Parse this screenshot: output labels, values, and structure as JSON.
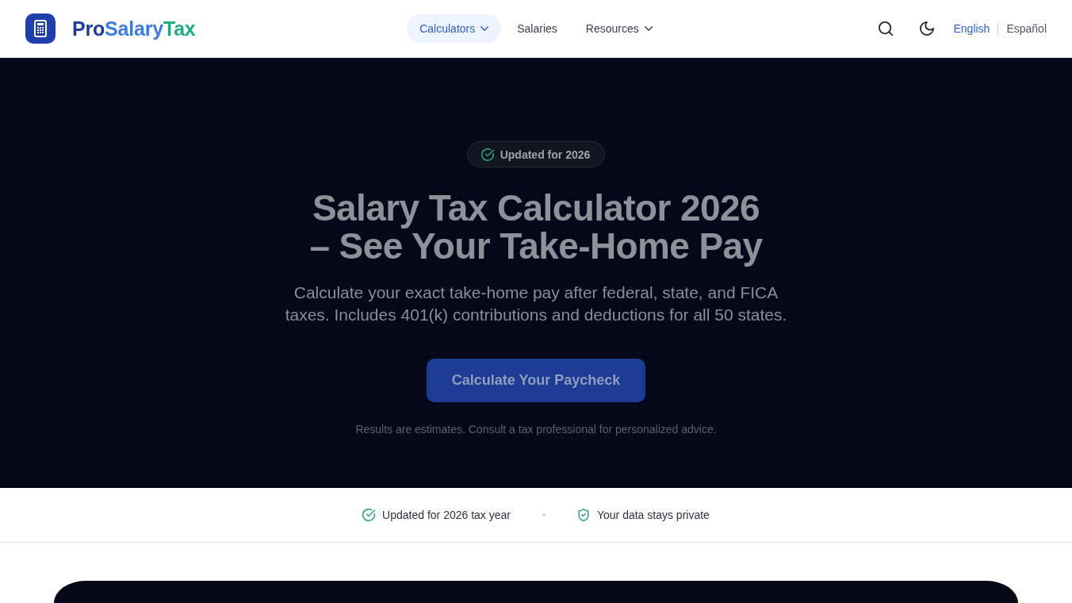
{
  "header": {
    "logo": [
      {
        "text": "Pro",
        "color": "#1f3c9e"
      },
      {
        "text": "Salary",
        "color": "#3b7be8"
      },
      {
        "text": "Tax",
        "color": "#1bb07c"
      }
    ],
    "nav": [
      {
        "label": "Calculators",
        "selected": true,
        "dropdown": true
      },
      {
        "label": "Salaries",
        "selected": false,
        "dropdown": false
      },
      {
        "label": "Resources",
        "selected": false,
        "dropdown": true
      }
    ],
    "languages": [
      {
        "label": "English",
        "selected": true
      },
      {
        "label": "Español",
        "selected": false
      }
    ]
  },
  "hero": {
    "badge": "Updated for 2026",
    "title": "Salary Tax Calculator 2026 – See Your Take-Home Pay",
    "subtitle": "Calculate your exact take-home pay after federal, state, and FICA taxes. Includes 401(k) contributions and deductions for all 50 states.",
    "button": "Calculate Your Paycheck",
    "disclaimer": "Results are estimates. Consult a tax professional for personalized advice."
  },
  "trust_bar": [
    {
      "kind": "check",
      "text": "Updated for 2026 tax year"
    },
    {
      "kind": "shield",
      "text": "Your data stays private"
    }
  ]
}
